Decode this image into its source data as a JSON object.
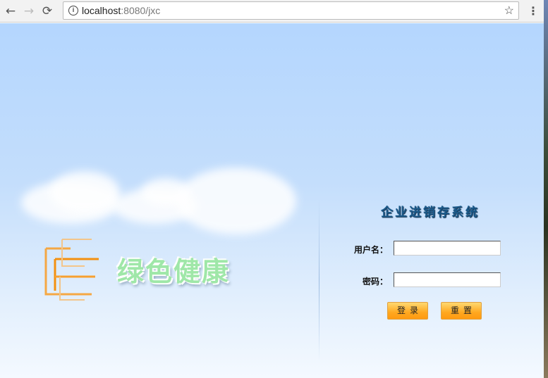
{
  "browser": {
    "url_host": "localhost",
    "url_path": ":8080/jxc",
    "back_icon": "←",
    "forward_icon": "→",
    "reload_icon": "⟳",
    "star_icon": "☆",
    "menu_icon": "⋮",
    "info_icon": "i"
  },
  "page": {
    "slogan": "绿色健康",
    "system_title": "企业进销存系统",
    "username_label": "用户名：",
    "username_value": "",
    "password_label": "密码：",
    "password_value": "",
    "login_label": "登录",
    "reset_label": "重置"
  }
}
